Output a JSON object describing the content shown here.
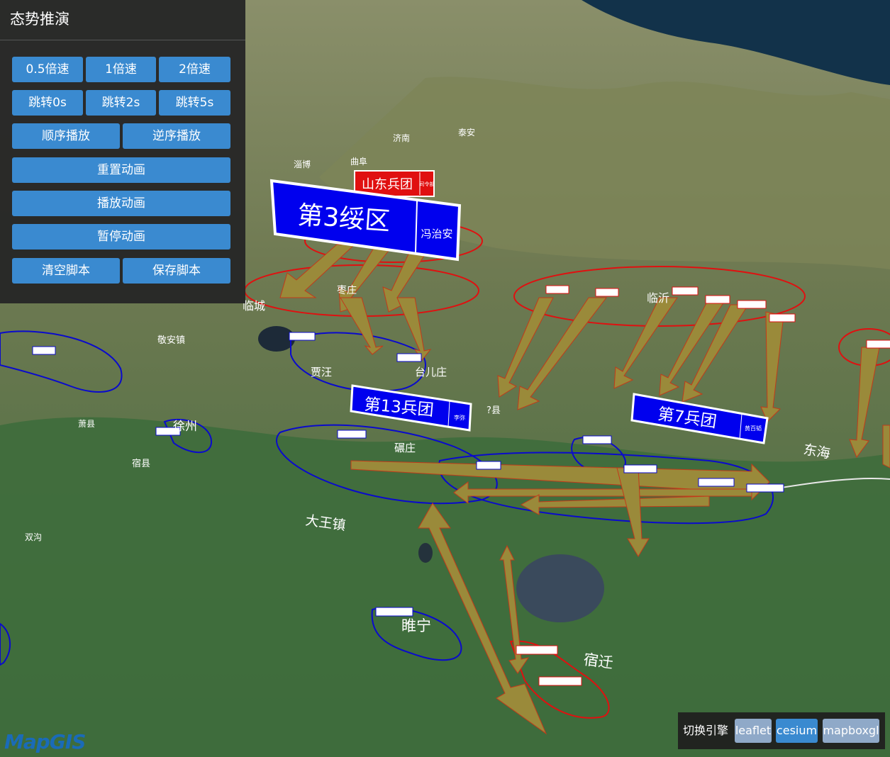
{
  "panel": {
    "title": "态势推演",
    "speed_half": "0.5倍速",
    "speed_1": "1倍速",
    "speed_2": "2倍速",
    "jump_0": "跳转0s",
    "jump_2": "跳转2s",
    "jump_5": "跳转5s",
    "play_forward": "顺序播放",
    "play_reverse": "逆序播放",
    "reset": "重置动画",
    "play": "播放动画",
    "pause": "暂停动画",
    "clear_script": "清空脚本",
    "save_script": "保存脚本"
  },
  "engine": {
    "label": "切换引擎",
    "leaflet": "leaflet",
    "cesium": "cesium",
    "mapboxgl": "mapboxgl",
    "active": "cesium"
  },
  "logo": "MapGIS",
  "places": {
    "jinan": "济南",
    "taian": "泰安",
    "zibo": "淄博",
    "qufu": "曲阜",
    "zaozhuang": "枣庄",
    "linyi": "临沂",
    "taierzhuang": "台儿庄",
    "jiawang": "贾汪",
    "xuzhou": "徐州",
    "suining": "睢宁",
    "suqian": "宿迁",
    "dawangzhen": "大王镇",
    "donghai": "东海",
    "pizhou": "碾庄",
    "lincheng": "临城",
    "jingan": "敬安镇",
    "xiaoxian": "萧县",
    "suxian": "宿县",
    "shuanggou": "双沟",
    "yixian": "?县"
  },
  "labels": {
    "sandong": "山东兵团",
    "sandong_sub": "司令部",
    "third": "第3绥区",
    "third_sub": "冯治安",
    "thirteen": "第13兵团",
    "thirteen_sub": "李弥",
    "seven": "第7兵团",
    "seven_sub": "黄百韬"
  },
  "colors": {
    "panel_bg": "#262626",
    "button": "#3a8ad0",
    "arrow_fill": "#9a8a3a",
    "friendly_red": "#e01010",
    "enemy_blue": "#0a0acc"
  }
}
